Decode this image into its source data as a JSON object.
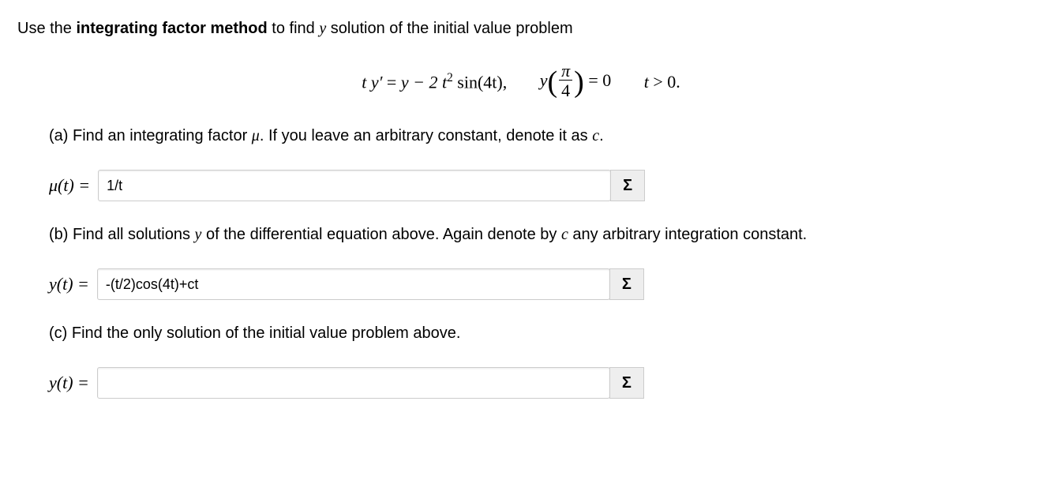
{
  "intro": {
    "pre": "Use the ",
    "bold": "integrating factor method",
    "mid": " to find ",
    "var_y": "y",
    "post": " solution of the initial value problem"
  },
  "equation": {
    "ode_lhs_ty": "t y′",
    "ode_eq": " = ",
    "ode_rhs": "y − 2 t",
    "ode_sup": "2",
    "ode_sin": " sin(4t),",
    "ic_y": "y",
    "ic_frac_num": "π",
    "ic_frac_den": "4",
    "ic_eq": " = 0",
    "domain_t": "t",
    "domain_rest": " > 0."
  },
  "part_a": {
    "text_pre": "(a) Find an integrating factor ",
    "mu": "μ",
    "text_mid": ". If you leave an arbitrary constant, denote it as ",
    "const_c": "c",
    "text_post": "."
  },
  "input_a": {
    "label_mu": "μ(t) = ",
    "value": "1/t",
    "sigma": "Σ"
  },
  "part_b": {
    "text_pre": "(b) Find all solutions ",
    "y": "y",
    "text_mid": " of the differential equation above. Again denote by ",
    "const_c": "c",
    "text_post": " any arbitrary integration constant."
  },
  "input_b": {
    "label_y": "y(t) = ",
    "value": "-(t/2)cos(4t)+ct",
    "sigma": "Σ"
  },
  "part_c": {
    "text": "(c) Find the only solution of the initial value problem above."
  },
  "input_c": {
    "label_y": "y(t) = ",
    "value": "",
    "sigma": "Σ"
  }
}
